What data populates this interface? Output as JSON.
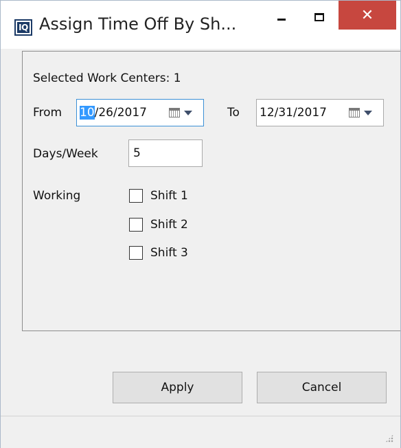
{
  "window": {
    "title": "Assign Time Off By Sh...",
    "app_icon_text": "IQ",
    "close_glyph": "✕"
  },
  "form": {
    "selected_work_centers_label": "Selected Work Centers:",
    "selected_work_centers_count": "1",
    "from_label": "From",
    "from_date_selected_part": "10",
    "from_date_rest": "/26/2017",
    "to_label": "To",
    "to_date": "12/31/2017",
    "days_week_label": "Days/Week",
    "days_week_value": "5",
    "working_label": "Working",
    "shifts": [
      {
        "label": "Shift 1",
        "checked": false
      },
      {
        "label": "Shift 2",
        "checked": false
      },
      {
        "label": "Shift 3",
        "checked": false
      }
    ]
  },
  "buttons": {
    "apply": "Apply",
    "cancel": "Cancel"
  },
  "icons": {
    "calendar": "calendar-icon",
    "dropdown": "chevron-down-icon",
    "minimize": "minimize-icon",
    "maximize": "maximize-icon",
    "close": "close-icon",
    "resize_grip": "resize-grip-icon"
  },
  "colors": {
    "close_button": "#c7473f",
    "selection": "#3399ff",
    "focus_border": "#3a8fd6",
    "app_icon": "#1b3a66"
  }
}
